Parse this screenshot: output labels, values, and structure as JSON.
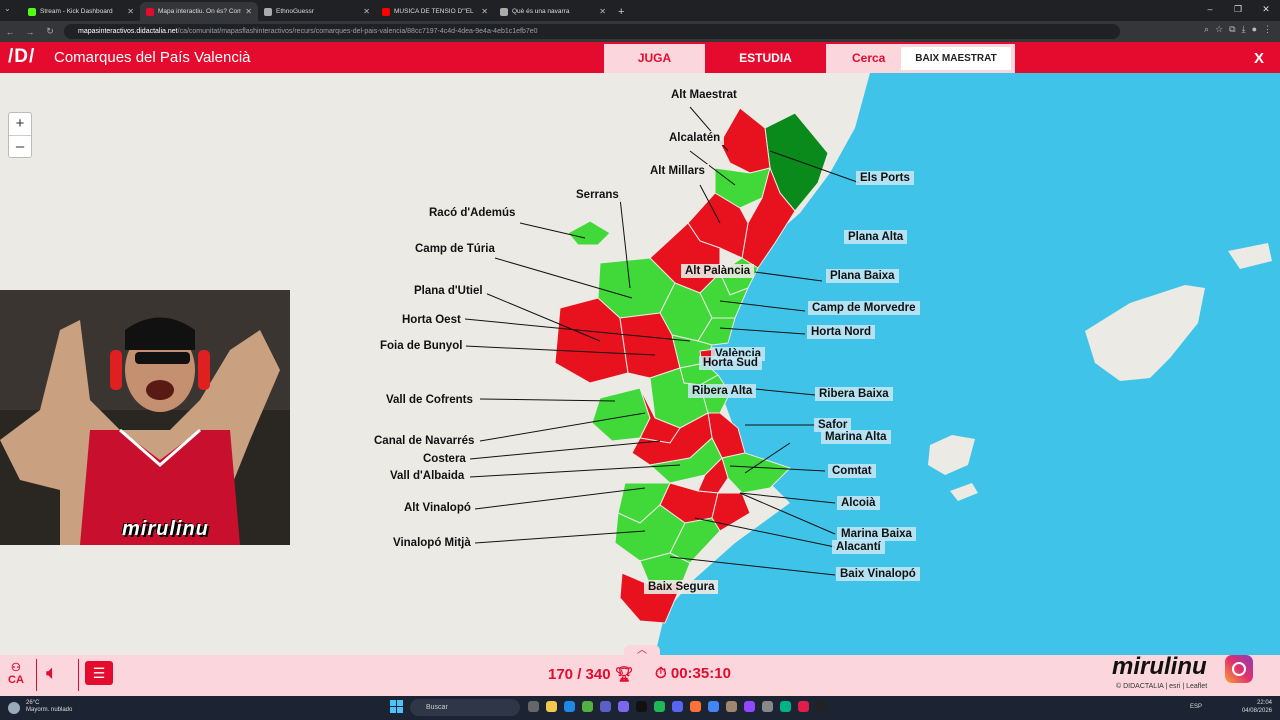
{
  "browser": {
    "tabs": [
      {
        "label": "Stream - Kick Dashboard",
        "color": "#53fc18"
      },
      {
        "label": "Mapa interactiu. On és? Comar",
        "color": "#e40b2e",
        "active": true
      },
      {
        "label": "EthnoGuessr",
        "color": "#aaaaaa"
      },
      {
        "label": "MÚSICA DE TENSIÓ D'\"EL",
        "color": "#ff0000"
      },
      {
        "label": "Què és una navarra",
        "color": "#aaaaaa"
      }
    ],
    "url_host": "mapasinteractivos.didactalia.net",
    "url_path": "/ca/comunitat/mapasflashinteractivos/recurs/comarques-del-pais-valencia/88cc7197-4c4d-4dea-9e4a-4eb1c1efb7e0"
  },
  "app": {
    "logo": "/D/",
    "title": "Comarques del País Valencià",
    "juga": "JUGA",
    "estudia": "ESTUDIA",
    "cerca": "Cerca",
    "target": "BAIX MAESTRAT",
    "close": "X",
    "zoom_in": "+",
    "zoom_out": "–"
  },
  "labels": {
    "alt_maestrat": "Alt Maestrat",
    "alcalaten": "Alcalatén",
    "alt_millars": "Alt Millars",
    "els_ports": "Els Ports",
    "serrans": "Serrans",
    "raco": "Racó d'Ademús",
    "plana_alta": "Plana Alta",
    "camp_turia": "Camp de Túria",
    "alt_palancia": "Alt Palància",
    "plana_baixa": "Plana Baixa",
    "plana_utiel": "Plana d'Utiel",
    "camp_morvedre": "Camp de Morvedre",
    "horta_oest": "Horta Oest",
    "horta_nord": "Horta Nord",
    "foia_bunyol": "Foia de Bunyol",
    "valencia": "València",
    "horta_sud": "Horta Sud",
    "vall_cofrents": "Vall de Cofrents",
    "ribera_alta": "Ribera Alta",
    "ribera_baixa": "Ribera Baixa",
    "safor": "Safor",
    "canal_navarres": "Canal de Navarrés",
    "marina_alta": "Marina Alta",
    "costera": "Costera",
    "comtat": "Comtat",
    "vall_albaida": "Vall d'Albaida",
    "alcoia": "Alcoià",
    "alt_vinalopo": "Alt Vinalopó",
    "marina_baixa": "Marina Baixa",
    "alacanti": "Alacantí",
    "vinalopo_mitja": "Vinalopó Mitjà",
    "baix_vinalopo": "Baix Vinalopó",
    "baix_segura": "Baix Segura"
  },
  "colors": {
    "brand": "#e40b2e",
    "correct": "#41d93a",
    "wrong": "#e8121f",
    "target_region": "#0a8a1a",
    "sea": "#3fc3e8"
  },
  "streamer": {
    "name": "mirulinu"
  },
  "footer": {
    "lang": "CA",
    "score": "170 / 340",
    "time": "00:35:10",
    "brand": "mirulinu",
    "credits": "© DIDACTALIA | esri | Leaflet"
  },
  "taskbar": {
    "temp": "26°C",
    "weather": "Mayorm. nublado",
    "search": "Buscar",
    "lang": "ESP",
    "time": "22:04",
    "date": "04/08/2026"
  }
}
